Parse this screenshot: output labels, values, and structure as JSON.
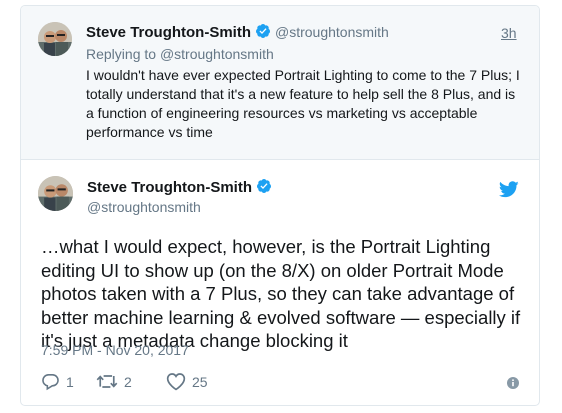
{
  "reply_tweet": {
    "author_name": "Steve Troughton-Smith",
    "author_handle": "@stroughtonsmith",
    "time": "3h",
    "replying_prefix": "Replying to",
    "replying_to": "@stroughtonsmith",
    "text": "I wouldn't have ever expected Portrait Lighting to come to the 7 Plus; I totally understand that it's a new feature to help sell the 8 Plus, and is a function of engineering resources vs marketing vs acceptable performance vs time"
  },
  "main_tweet": {
    "author_name": "Steve Troughton-Smith",
    "author_handle": "@stroughtonsmith",
    "text": "…what I would expect, however, is the Portrait Lighting editing UI to show up (on the 8/X) on older Portrait Mode photos taken with a 7 Plus, so they can take advantage of better machine learning & evolved software — especially if it's just a metadata change blocking it",
    "timestamp": "7:59 PM - Nov 20, 2017",
    "reply_count": "1",
    "retweet_count": "2",
    "like_count": "25"
  },
  "icons": {
    "verified": "verified-badge-icon",
    "twitter": "twitter-bird-icon",
    "reply": "reply-icon",
    "retweet": "retweet-icon",
    "like": "heart-icon",
    "info": "info-icon"
  },
  "colors": {
    "twitter_blue": "#1da1f2",
    "text_primary": "#14171a",
    "text_secondary": "#657786",
    "reply_bg": "#f5f8fa",
    "border": "#e1e8ed"
  }
}
